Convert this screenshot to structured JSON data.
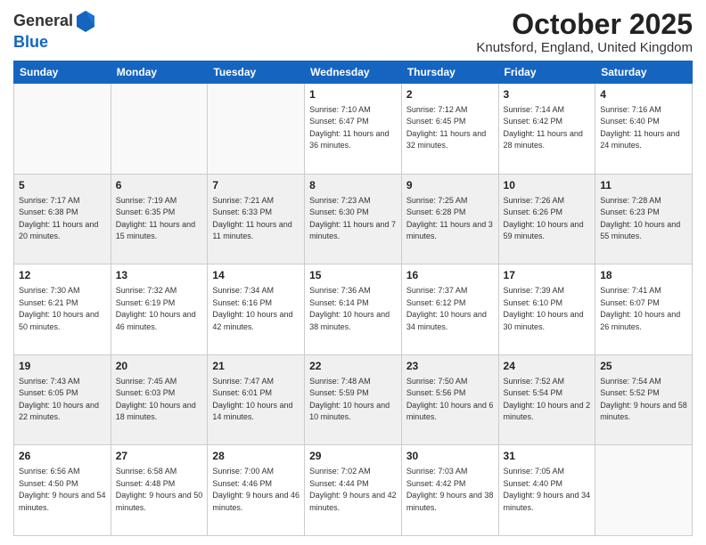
{
  "logo": {
    "line1": "General",
    "line2": "Blue"
  },
  "title": "October 2025",
  "location": "Knutsford, England, United Kingdom",
  "weekdays": [
    "Sunday",
    "Monday",
    "Tuesday",
    "Wednesday",
    "Thursday",
    "Friday",
    "Saturday"
  ],
  "weeks": [
    [
      {
        "day": "",
        "sunrise": "",
        "sunset": "",
        "daylight": "",
        "empty": true
      },
      {
        "day": "",
        "sunrise": "",
        "sunset": "",
        "daylight": "",
        "empty": true
      },
      {
        "day": "",
        "sunrise": "",
        "sunset": "",
        "daylight": "",
        "empty": true
      },
      {
        "day": "1",
        "sunrise": "Sunrise: 7:10 AM",
        "sunset": "Sunset: 6:47 PM",
        "daylight": "Daylight: 11 hours and 36 minutes."
      },
      {
        "day": "2",
        "sunrise": "Sunrise: 7:12 AM",
        "sunset": "Sunset: 6:45 PM",
        "daylight": "Daylight: 11 hours and 32 minutes."
      },
      {
        "day": "3",
        "sunrise": "Sunrise: 7:14 AM",
        "sunset": "Sunset: 6:42 PM",
        "daylight": "Daylight: 11 hours and 28 minutes."
      },
      {
        "day": "4",
        "sunrise": "Sunrise: 7:16 AM",
        "sunset": "Sunset: 6:40 PM",
        "daylight": "Daylight: 11 hours and 24 minutes."
      }
    ],
    [
      {
        "day": "5",
        "sunrise": "Sunrise: 7:17 AM",
        "sunset": "Sunset: 6:38 PM",
        "daylight": "Daylight: 11 hours and 20 minutes."
      },
      {
        "day": "6",
        "sunrise": "Sunrise: 7:19 AM",
        "sunset": "Sunset: 6:35 PM",
        "daylight": "Daylight: 11 hours and 15 minutes."
      },
      {
        "day": "7",
        "sunrise": "Sunrise: 7:21 AM",
        "sunset": "Sunset: 6:33 PM",
        "daylight": "Daylight: 11 hours and 11 minutes."
      },
      {
        "day": "8",
        "sunrise": "Sunrise: 7:23 AM",
        "sunset": "Sunset: 6:30 PM",
        "daylight": "Daylight: 11 hours and 7 minutes."
      },
      {
        "day": "9",
        "sunrise": "Sunrise: 7:25 AM",
        "sunset": "Sunset: 6:28 PM",
        "daylight": "Daylight: 11 hours and 3 minutes."
      },
      {
        "day": "10",
        "sunrise": "Sunrise: 7:26 AM",
        "sunset": "Sunset: 6:26 PM",
        "daylight": "Daylight: 10 hours and 59 minutes."
      },
      {
        "day": "11",
        "sunrise": "Sunrise: 7:28 AM",
        "sunset": "Sunset: 6:23 PM",
        "daylight": "Daylight: 10 hours and 55 minutes."
      }
    ],
    [
      {
        "day": "12",
        "sunrise": "Sunrise: 7:30 AM",
        "sunset": "Sunset: 6:21 PM",
        "daylight": "Daylight: 10 hours and 50 minutes."
      },
      {
        "day": "13",
        "sunrise": "Sunrise: 7:32 AM",
        "sunset": "Sunset: 6:19 PM",
        "daylight": "Daylight: 10 hours and 46 minutes."
      },
      {
        "day": "14",
        "sunrise": "Sunrise: 7:34 AM",
        "sunset": "Sunset: 6:16 PM",
        "daylight": "Daylight: 10 hours and 42 minutes."
      },
      {
        "day": "15",
        "sunrise": "Sunrise: 7:36 AM",
        "sunset": "Sunset: 6:14 PM",
        "daylight": "Daylight: 10 hours and 38 minutes."
      },
      {
        "day": "16",
        "sunrise": "Sunrise: 7:37 AM",
        "sunset": "Sunset: 6:12 PM",
        "daylight": "Daylight: 10 hours and 34 minutes."
      },
      {
        "day": "17",
        "sunrise": "Sunrise: 7:39 AM",
        "sunset": "Sunset: 6:10 PM",
        "daylight": "Daylight: 10 hours and 30 minutes."
      },
      {
        "day": "18",
        "sunrise": "Sunrise: 7:41 AM",
        "sunset": "Sunset: 6:07 PM",
        "daylight": "Daylight: 10 hours and 26 minutes."
      }
    ],
    [
      {
        "day": "19",
        "sunrise": "Sunrise: 7:43 AM",
        "sunset": "Sunset: 6:05 PM",
        "daylight": "Daylight: 10 hours and 22 minutes."
      },
      {
        "day": "20",
        "sunrise": "Sunrise: 7:45 AM",
        "sunset": "Sunset: 6:03 PM",
        "daylight": "Daylight: 10 hours and 18 minutes."
      },
      {
        "day": "21",
        "sunrise": "Sunrise: 7:47 AM",
        "sunset": "Sunset: 6:01 PM",
        "daylight": "Daylight: 10 hours and 14 minutes."
      },
      {
        "day": "22",
        "sunrise": "Sunrise: 7:48 AM",
        "sunset": "Sunset: 5:59 PM",
        "daylight": "Daylight: 10 hours and 10 minutes."
      },
      {
        "day": "23",
        "sunrise": "Sunrise: 7:50 AM",
        "sunset": "Sunset: 5:56 PM",
        "daylight": "Daylight: 10 hours and 6 minutes."
      },
      {
        "day": "24",
        "sunrise": "Sunrise: 7:52 AM",
        "sunset": "Sunset: 5:54 PM",
        "daylight": "Daylight: 10 hours and 2 minutes."
      },
      {
        "day": "25",
        "sunrise": "Sunrise: 7:54 AM",
        "sunset": "Sunset: 5:52 PM",
        "daylight": "Daylight: 9 hours and 58 minutes."
      }
    ],
    [
      {
        "day": "26",
        "sunrise": "Sunrise: 6:56 AM",
        "sunset": "Sunset: 4:50 PM",
        "daylight": "Daylight: 9 hours and 54 minutes."
      },
      {
        "day": "27",
        "sunrise": "Sunrise: 6:58 AM",
        "sunset": "Sunset: 4:48 PM",
        "daylight": "Daylight: 9 hours and 50 minutes."
      },
      {
        "day": "28",
        "sunrise": "Sunrise: 7:00 AM",
        "sunset": "Sunset: 4:46 PM",
        "daylight": "Daylight: 9 hours and 46 minutes."
      },
      {
        "day": "29",
        "sunrise": "Sunrise: 7:02 AM",
        "sunset": "Sunset: 4:44 PM",
        "daylight": "Daylight: 9 hours and 42 minutes."
      },
      {
        "day": "30",
        "sunrise": "Sunrise: 7:03 AM",
        "sunset": "Sunset: 4:42 PM",
        "daylight": "Daylight: 9 hours and 38 minutes."
      },
      {
        "day": "31",
        "sunrise": "Sunrise: 7:05 AM",
        "sunset": "Sunset: 4:40 PM",
        "daylight": "Daylight: 9 hours and 34 minutes."
      },
      {
        "day": "",
        "sunrise": "",
        "sunset": "",
        "daylight": "",
        "empty": true
      }
    ]
  ]
}
